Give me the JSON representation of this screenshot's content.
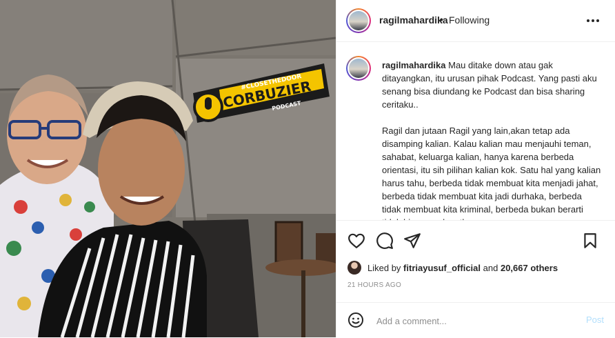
{
  "post": {
    "author": {
      "username": "ragilmahardika",
      "separator": "•",
      "follow_status": "Following"
    },
    "photo": {
      "sign": {
        "hashtag": "#CLOSETHEDOOR",
        "brand": "CORBUZIER",
        "sub": "PODCAST"
      }
    },
    "caption": {
      "username": "ragilmahardika",
      "text": " Mau ditake down atau gak ditayangkan, itu urusan pihak Podcast. Yang pasti aku senang bisa diundang ke Podcast dan bisa sharing ceritaku..\n\nRagil dan jutaan Ragil yang lain,akan tetap ada disamping kalian. Kalau kalian mau menjauhi teman, sahabat, keluarga kalian, hanya karena berbeda orientasi, itu sih pilihan kalian kok. Satu hal yang kalian harus tahu, berbeda tidak membuat kita menjadi jahat, berbeda tidak membuat kita jadi durhaka, berbeda tidak membuat kita kriminal, berbeda bukan berarti tidak bisa mendapatkan"
    },
    "actions": {
      "like_icon": "heart-icon",
      "comment_icon": "comment-icon",
      "share_icon": "paper-plane-icon",
      "save_icon": "bookmark-icon"
    },
    "likes": {
      "prefix": "Liked by",
      "user": "fitriayusuf_official",
      "middle": "and",
      "others": "20,667 others"
    },
    "timestamp": "21 HOURS AGO",
    "comment_box": {
      "emoji_icon": "smiley-icon",
      "placeholder": "Add a comment...",
      "post_label": "Post"
    },
    "colors": {
      "post_disabled": "#b2dffc",
      "sign_yellow": "#f4c400",
      "secondary_text": "#8e8e8e"
    }
  }
}
